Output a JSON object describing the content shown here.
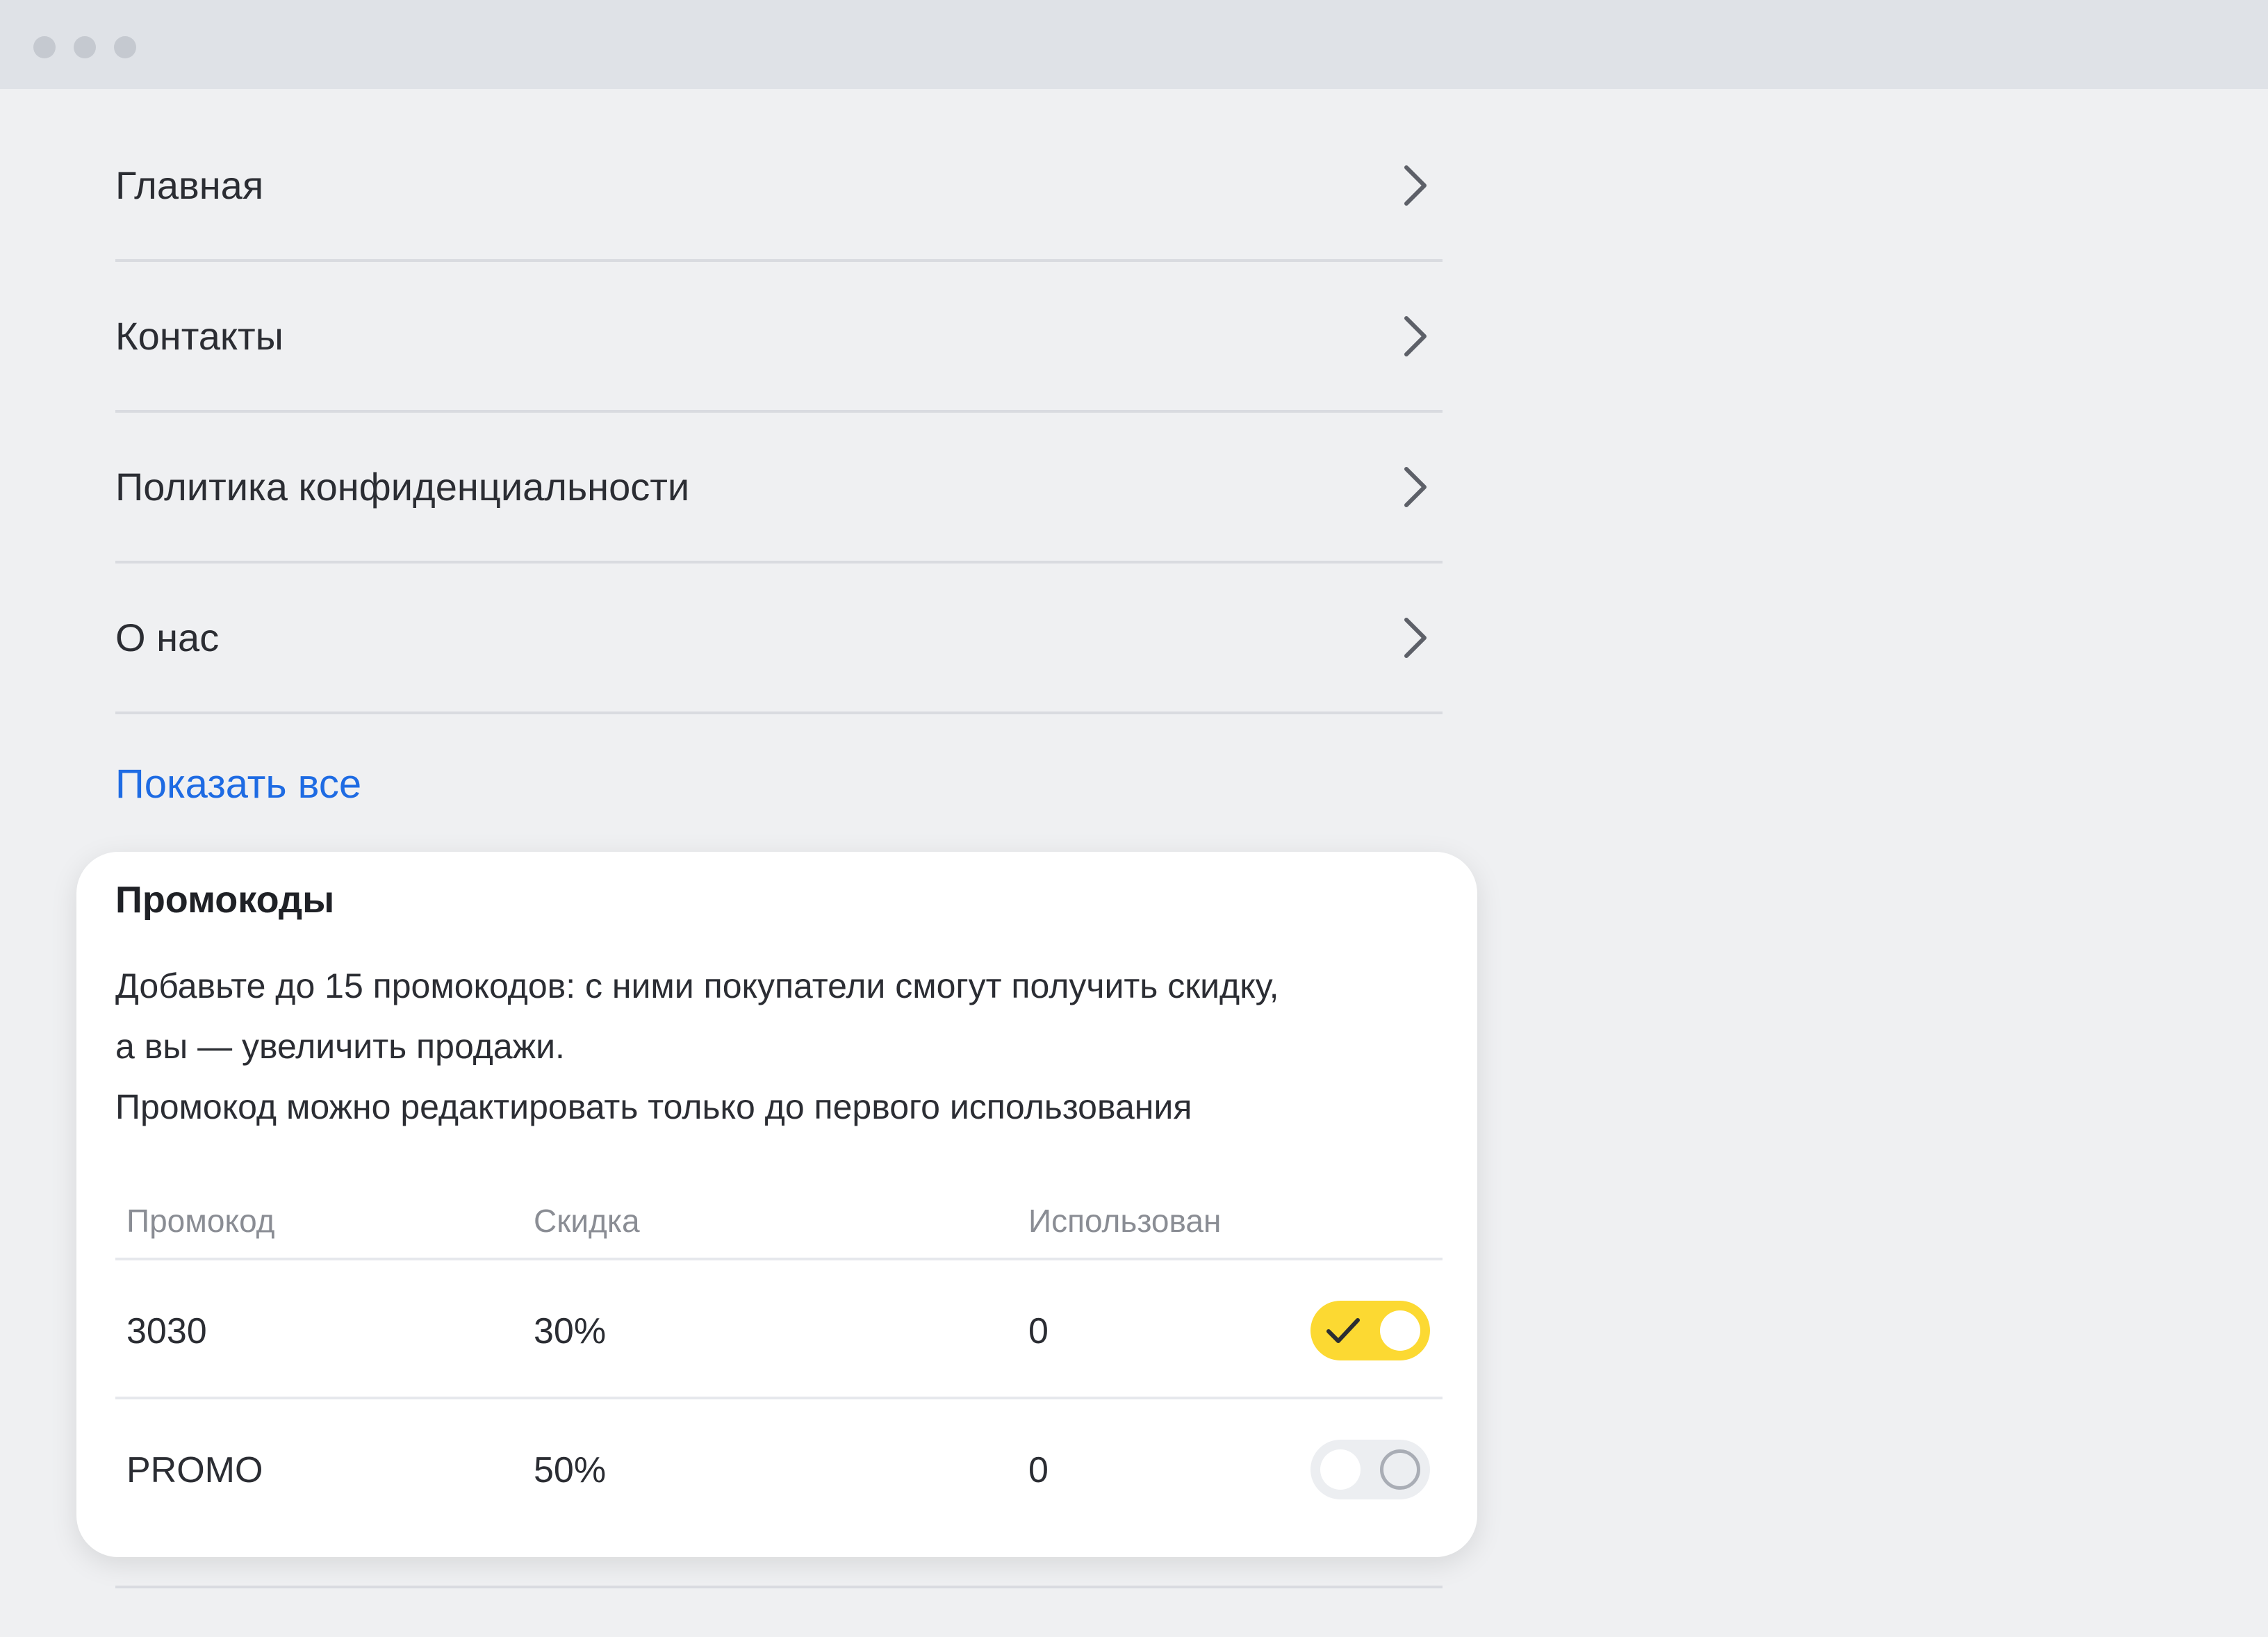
{
  "nav": {
    "items": [
      {
        "label": "Главная"
      },
      {
        "label": "Контакты"
      },
      {
        "label": "Политика конфиденциальности"
      },
      {
        "label": "О нас"
      }
    ],
    "show_all": "Показать все"
  },
  "promo": {
    "title": "Промокоды",
    "description_lines": [
      "Добавьте до 15 промокодов: с ними покупатели смогут получить скидку,",
      "а вы — увеличить продажи.",
      "Промокод можно редактировать только до первого использования"
    ],
    "columns": [
      "Промокод",
      "Скидка",
      "Использован"
    ],
    "rows": [
      {
        "code": "3030",
        "discount": "30%",
        "used": "0",
        "enabled": true
      },
      {
        "code": "PROMO",
        "discount": "50%",
        "used": "0",
        "enabled": false
      }
    ]
  },
  "colors": {
    "accent_link": "#1e6be3",
    "toggle_on": "#fcd932",
    "toggle_off": "#eceef1"
  },
  "icons": {
    "nav_item": "chevron-right-icon",
    "toggle_on": "check-icon"
  }
}
